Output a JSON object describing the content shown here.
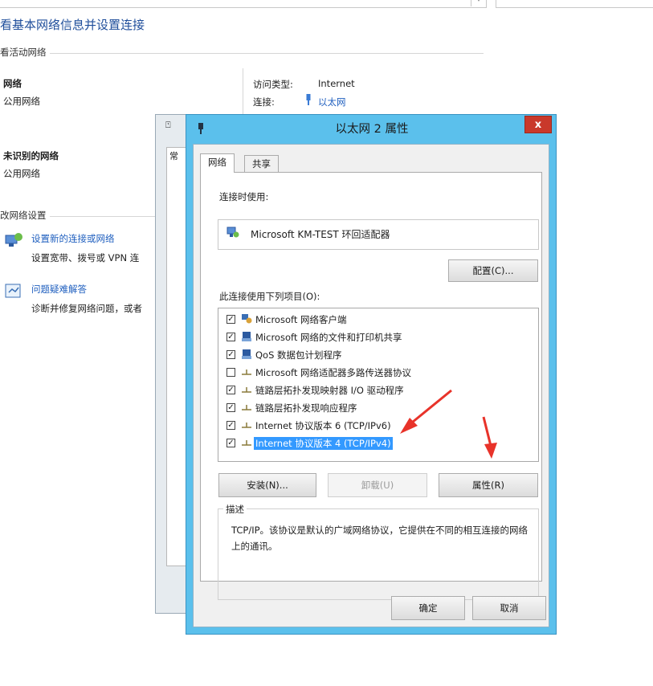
{
  "background": {
    "page_title": "看基本网络信息并设置连接",
    "active_networks_header": "看活动网络",
    "network1": {
      "name": "网络",
      "type": "公用网络"
    },
    "access_type_label": "访问类型:",
    "access_type_value": "Internet",
    "connection_label": "连接:",
    "connection_value": "以太网",
    "network2": {
      "name": "未识别的网络",
      "type": "公用网络"
    },
    "change_settings_header": "改网络设置",
    "setup_link": "设置新的连接或网络",
    "setup_desc": "设置宽带、拨号或 VPN 连",
    "troubleshoot_link": "问题疑难解答",
    "troubleshoot_desc": "诊断并修复网络问题，或者",
    "back_dialog_tab": "常"
  },
  "dialog": {
    "title": "以太网 2 属性",
    "close_label": "x",
    "tabs": [
      {
        "label": "网络"
      },
      {
        "label": "共享"
      }
    ],
    "connect_using_label": "连接时使用:",
    "adapter_name": "Microsoft KM-TEST 环回适配器",
    "configure_button": "配置(C)...",
    "items_label": "此连接使用下列项目(O):",
    "items": [
      {
        "checked": true,
        "label": "Microsoft 网络客户端",
        "icon": "network-client-icon"
      },
      {
        "checked": true,
        "label": "Microsoft 网络的文件和打印机共享",
        "icon": "file-printer-sharing-icon"
      },
      {
        "checked": true,
        "label": "QoS 数据包计划程序",
        "icon": "qos-icon"
      },
      {
        "checked": false,
        "label": "Microsoft 网络适配器多路传送器协议",
        "icon": "protocol-icon"
      },
      {
        "checked": true,
        "label": "链路层拓扑发现映射器 I/O 驱动程序",
        "icon": "protocol-icon"
      },
      {
        "checked": true,
        "label": "链路层拓扑发现响应程序",
        "icon": "protocol-icon"
      },
      {
        "checked": true,
        "label": "Internet 协议版本 6 (TCP/IPv6)",
        "icon": "protocol-icon"
      },
      {
        "checked": true,
        "label": "Internet 协议版本 4 (TCP/IPv4)",
        "icon": "protocol-icon",
        "selected": true
      }
    ],
    "install_button": "安装(N)...",
    "uninstall_button": "卸载(U)",
    "properties_button": "属性(R)",
    "description_label": "描述",
    "description_text": "TCP/IP。该协议是默认的广域网络协议，它提供在不同的相互连接的网络上的通讯。",
    "ok_button": "确定",
    "cancel_button": "取消",
    "annotation_color": "#e8332a",
    "selection_color": "#3399ff"
  }
}
